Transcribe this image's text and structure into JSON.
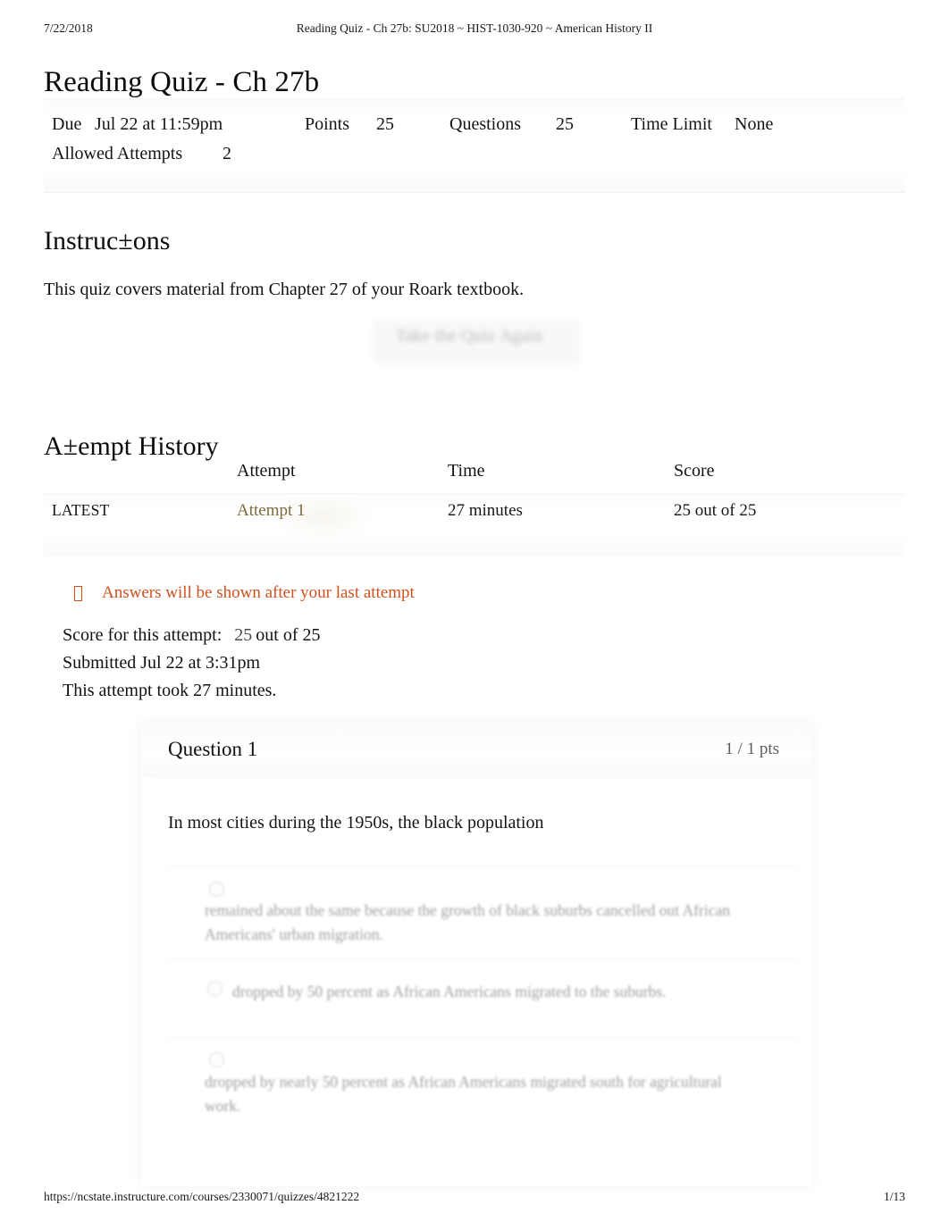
{
  "print_header": {
    "date": "7/22/2018",
    "title": "Reading Quiz - Ch 27b: SU2018 ~ HIST-1030-920 ~ American History II"
  },
  "page_title": "Reading Quiz - Ch 27b",
  "quiz_details": {
    "due_label": "Due",
    "due_value": "Jul 22 at 11:59pm",
    "points_label": "Points",
    "points_value": "25",
    "questions_label": "Questions",
    "questions_value": "25",
    "time_limit_label": "Time Limit",
    "time_limit_value": "None",
    "allowed_attempts_label": "Allowed Attempts",
    "allowed_attempts_value": "2"
  },
  "instructions": {
    "heading": "Instruc±ons",
    "body": "This quiz covers material from Chapter 27 of your Roark textbook."
  },
  "retake": {
    "label": "Take the Quiz Again"
  },
  "attempt_history": {
    "heading": "A±empt History",
    "columns": [
      "",
      "Attempt",
      "Time",
      "Score"
    ],
    "rows": [
      {
        "marker": "LATEST",
        "attempt": "Attempt 1",
        "time": "27 minutes",
        "score": "25 out of 25"
      }
    ],
    "link_color": "#7d6a3a"
  },
  "notice": {
    "icon": "missing-glyph-box",
    "text": "Answers will be shown after your last attempt",
    "color": "#d0511e"
  },
  "attempt_summary": {
    "score_label": "Score for this attempt:",
    "score_value": "25",
    "score_outof": "out of 25",
    "submitted": "Submitted Jul 22 at 3:31pm",
    "duration": "This attempt took 27 minutes."
  },
  "question": {
    "number": "Question 1",
    "points": "1 / 1 pts",
    "prompt": "In most cities during the 1950s, the black population",
    "answers": [
      "remained about the same because the growth of black suburbs cancelled out African Americans' urban migration.",
      "dropped by 50 percent as African Americans migrated to the suburbs.",
      "dropped by nearly 50 percent as African Americans migrated south for agricultural work."
    ]
  },
  "print_footer": {
    "url": "https://ncstate.instructure.com/courses/2330071/quizzes/4821222",
    "page": "1/13"
  }
}
